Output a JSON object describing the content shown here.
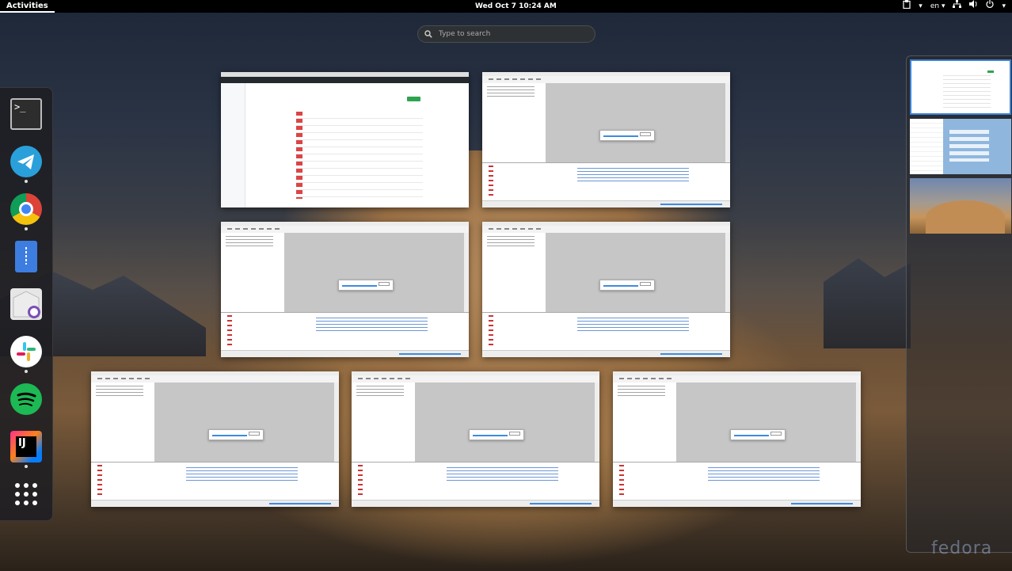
{
  "topbar": {
    "activities": "Activities",
    "clock": "Wed Oct 7  10:24 AM",
    "language": "en"
  },
  "search": {
    "placeholder": "Type to search"
  },
  "dock": {
    "apps": [
      {
        "name": "Terminal",
        "icon": "terminal-icon",
        "glyph": ">_",
        "running": false
      },
      {
        "name": "Telegram",
        "icon": "telegram-icon",
        "running": true
      },
      {
        "name": "Google Chrome",
        "icon": "chrome-icon",
        "running": true
      },
      {
        "name": "Files",
        "icon": "files-icon",
        "running": false
      },
      {
        "name": "Mail",
        "icon": "mail-icon",
        "running": false
      },
      {
        "name": "Slack",
        "icon": "slack-icon",
        "running": true
      },
      {
        "name": "Spotify",
        "icon": "spotify-icon",
        "running": false
      },
      {
        "name": "IntelliJ IDEA",
        "icon": "intellij-icon",
        "glyph": "IJ",
        "running": true
      },
      {
        "name": "Show Applications",
        "icon": "app-grid-icon",
        "running": false
      }
    ]
  },
  "windows": [
    {
      "kind": "browser",
      "app": "Google Chrome"
    },
    {
      "kind": "ide",
      "app": "IntelliJ IDEA"
    },
    {
      "kind": "ide",
      "app": "IntelliJ IDEA"
    },
    {
      "kind": "ide",
      "app": "IntelliJ IDEA"
    },
    {
      "kind": "ide",
      "app": "IntelliJ IDEA"
    },
    {
      "kind": "ide",
      "app": "IntelliJ IDEA"
    },
    {
      "kind": "ide",
      "app": "IntelliJ IDEA"
    }
  ],
  "workspaces": [
    {
      "index": 1,
      "active": true
    },
    {
      "index": 2,
      "active": false
    },
    {
      "index": 3,
      "active": false
    }
  ],
  "watermark": "fedora",
  "colors": {
    "accent": "#3b82d6",
    "topbar": "#000000"
  }
}
